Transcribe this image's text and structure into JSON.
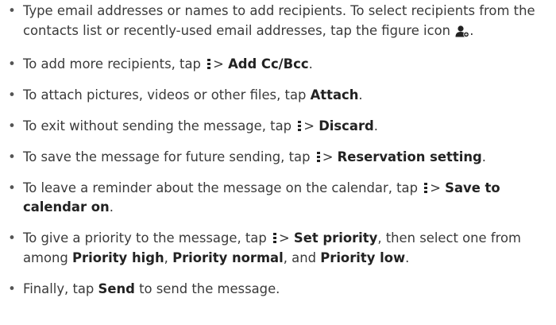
{
  "items": [
    {
      "parts": [
        {
          "t": "Type email addresses or names to add recipients. To select recipients from the contacts list or recently-used email addresses, tap the figure icon "
        },
        {
          "icon": "figure-icon"
        },
        {
          "t": "."
        }
      ]
    },
    {
      "parts": [
        {
          "t": "To add more recipients, tap "
        },
        {
          "icon": "menu-icon"
        },
        {
          "t": "> "
        },
        {
          "b": "Add Cc/Bcc"
        },
        {
          "t": "."
        }
      ]
    },
    {
      "parts": [
        {
          "t": "To attach pictures, videos or other files, tap "
        },
        {
          "b": "Attach"
        },
        {
          "t": "."
        }
      ]
    },
    {
      "parts": [
        {
          "t": "To exit without sending the message, tap "
        },
        {
          "icon": "menu-icon"
        },
        {
          "t": "> "
        },
        {
          "b": "Discard"
        },
        {
          "t": "."
        }
      ]
    },
    {
      "parts": [
        {
          "t": "To save the message for future sending, tap "
        },
        {
          "icon": "menu-icon"
        },
        {
          "t": "> "
        },
        {
          "b": "Reservation setting"
        },
        {
          "t": "."
        }
      ]
    },
    {
      "parts": [
        {
          "t": "To leave a reminder about the message on the calendar, tap "
        },
        {
          "icon": "menu-icon"
        },
        {
          "t": "> "
        },
        {
          "b": "Save to calendar on"
        },
        {
          "t": "."
        }
      ]
    },
    {
      "parts": [
        {
          "t": "To give a priority to the message, tap "
        },
        {
          "icon": "menu-icon"
        },
        {
          "t": "> "
        },
        {
          "b": "Set priority"
        },
        {
          "t": ", then select one from among "
        },
        {
          "b": "Priority high"
        },
        {
          "t": ", "
        },
        {
          "b": "Priority normal"
        },
        {
          "t": ", and "
        },
        {
          "b": "Priority low"
        },
        {
          "t": "."
        }
      ]
    },
    {
      "parts": [
        {
          "t": "Finally, tap "
        },
        {
          "b": "Send"
        },
        {
          "t": " to send the message."
        }
      ]
    }
  ],
  "bullet_char": "•",
  "colors": {
    "text": "#3a3a3a",
    "bold": "#222222",
    "icon": "#222222"
  }
}
